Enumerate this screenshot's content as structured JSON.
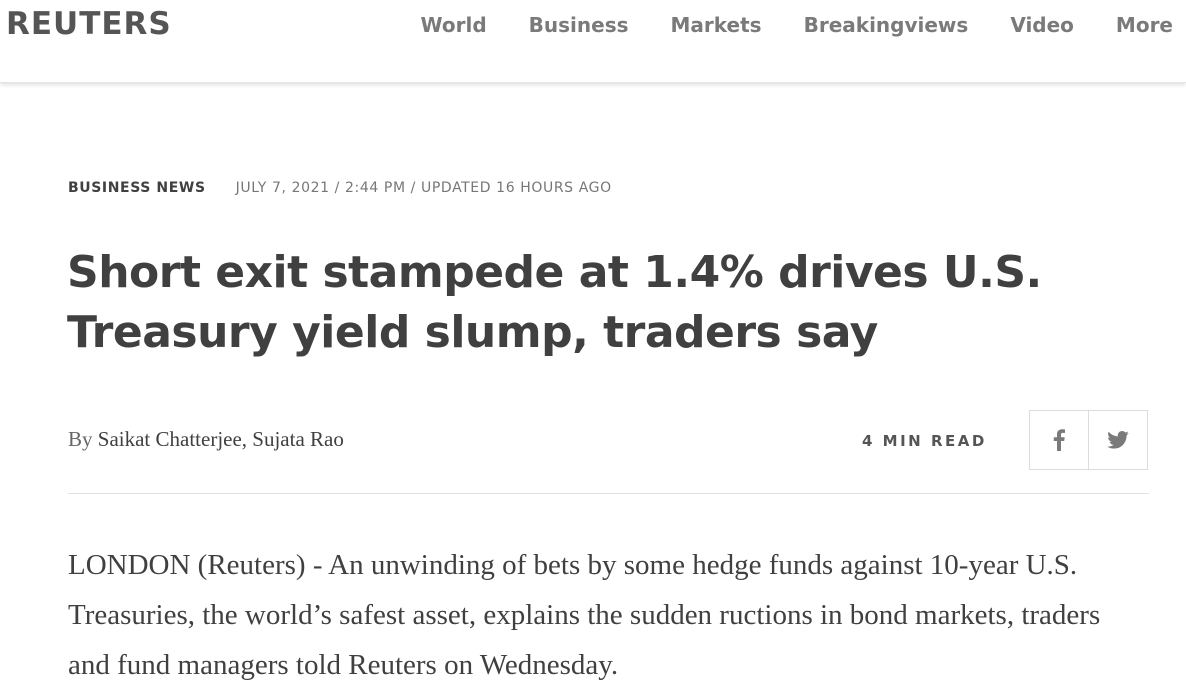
{
  "header": {
    "logo": "REUTERS",
    "nav": [
      "World",
      "Business",
      "Markets",
      "Breakingviews",
      "Video",
      "More"
    ]
  },
  "article": {
    "section": "BUSINESS NEWS",
    "dateline": "JULY 7, 2021 / 2:44 PM / UPDATED 16 HOURS AGO",
    "headline": "Short exit stampede at 1.4% drives U.S. Treasury yield slump, traders say",
    "byline_prefix": "By",
    "authors": "Saikat Chatterjee, Sujata Rao",
    "read_time": "4 MIN READ",
    "share": {
      "facebook_icon": "facebook-icon",
      "twitter_icon": "twitter-icon"
    },
    "body": "LONDON (Reuters) - An unwinding of bets by some hedge funds against 10-year U.S. Treasuries, the world’s safest asset, explains the sudden ructions in bond markets, traders and fund managers told Reuters on Wednesday."
  }
}
